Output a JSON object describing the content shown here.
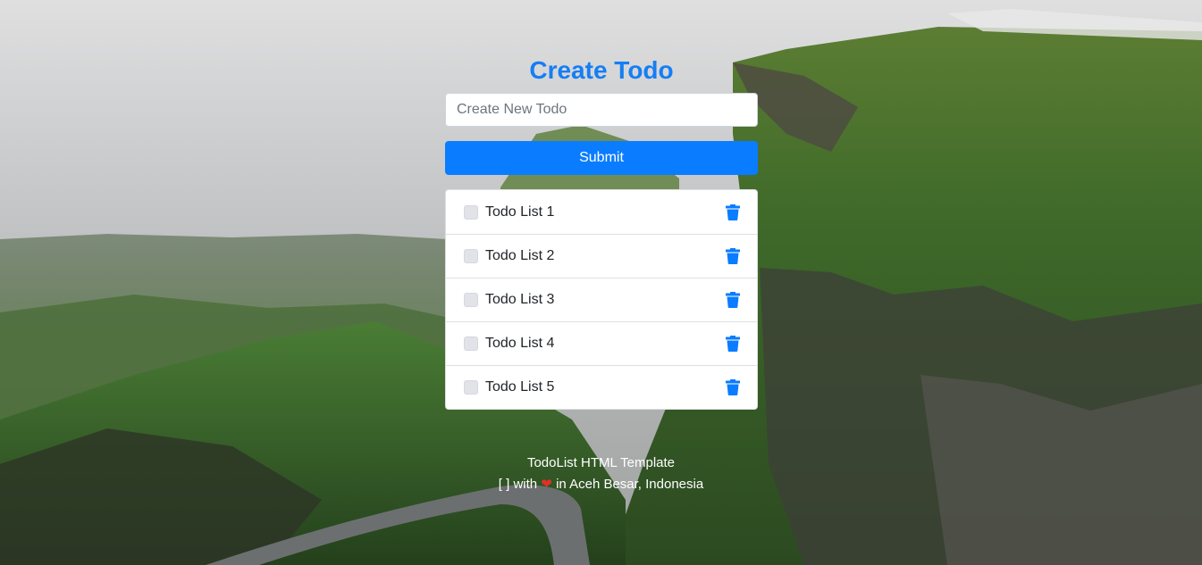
{
  "header": {
    "title": "Create Todo"
  },
  "form": {
    "placeholder": "Create New Todo",
    "value": "",
    "submit_label": "Submit"
  },
  "todos": [
    {
      "label": "Todo List 1",
      "done": false
    },
    {
      "label": "Todo List 2",
      "done": false
    },
    {
      "label": "Todo List 3",
      "done": false
    },
    {
      "label": "Todo List 4",
      "done": false
    },
    {
      "label": "Todo List 5",
      "done": false
    }
  ],
  "icons": {
    "checkbox": "checkbox-icon",
    "delete": "trash-icon",
    "heart": "heart-icon"
  },
  "footer": {
    "line1": "TodoList HTML Template",
    "line2_prefix": "[ ] with",
    "heart": "❤",
    "line2_suffix": "in Aceh Besar, Indonesia"
  },
  "colors": {
    "accent": "#0a7cff",
    "title": "#157ef4",
    "heart": "#e0302a"
  }
}
